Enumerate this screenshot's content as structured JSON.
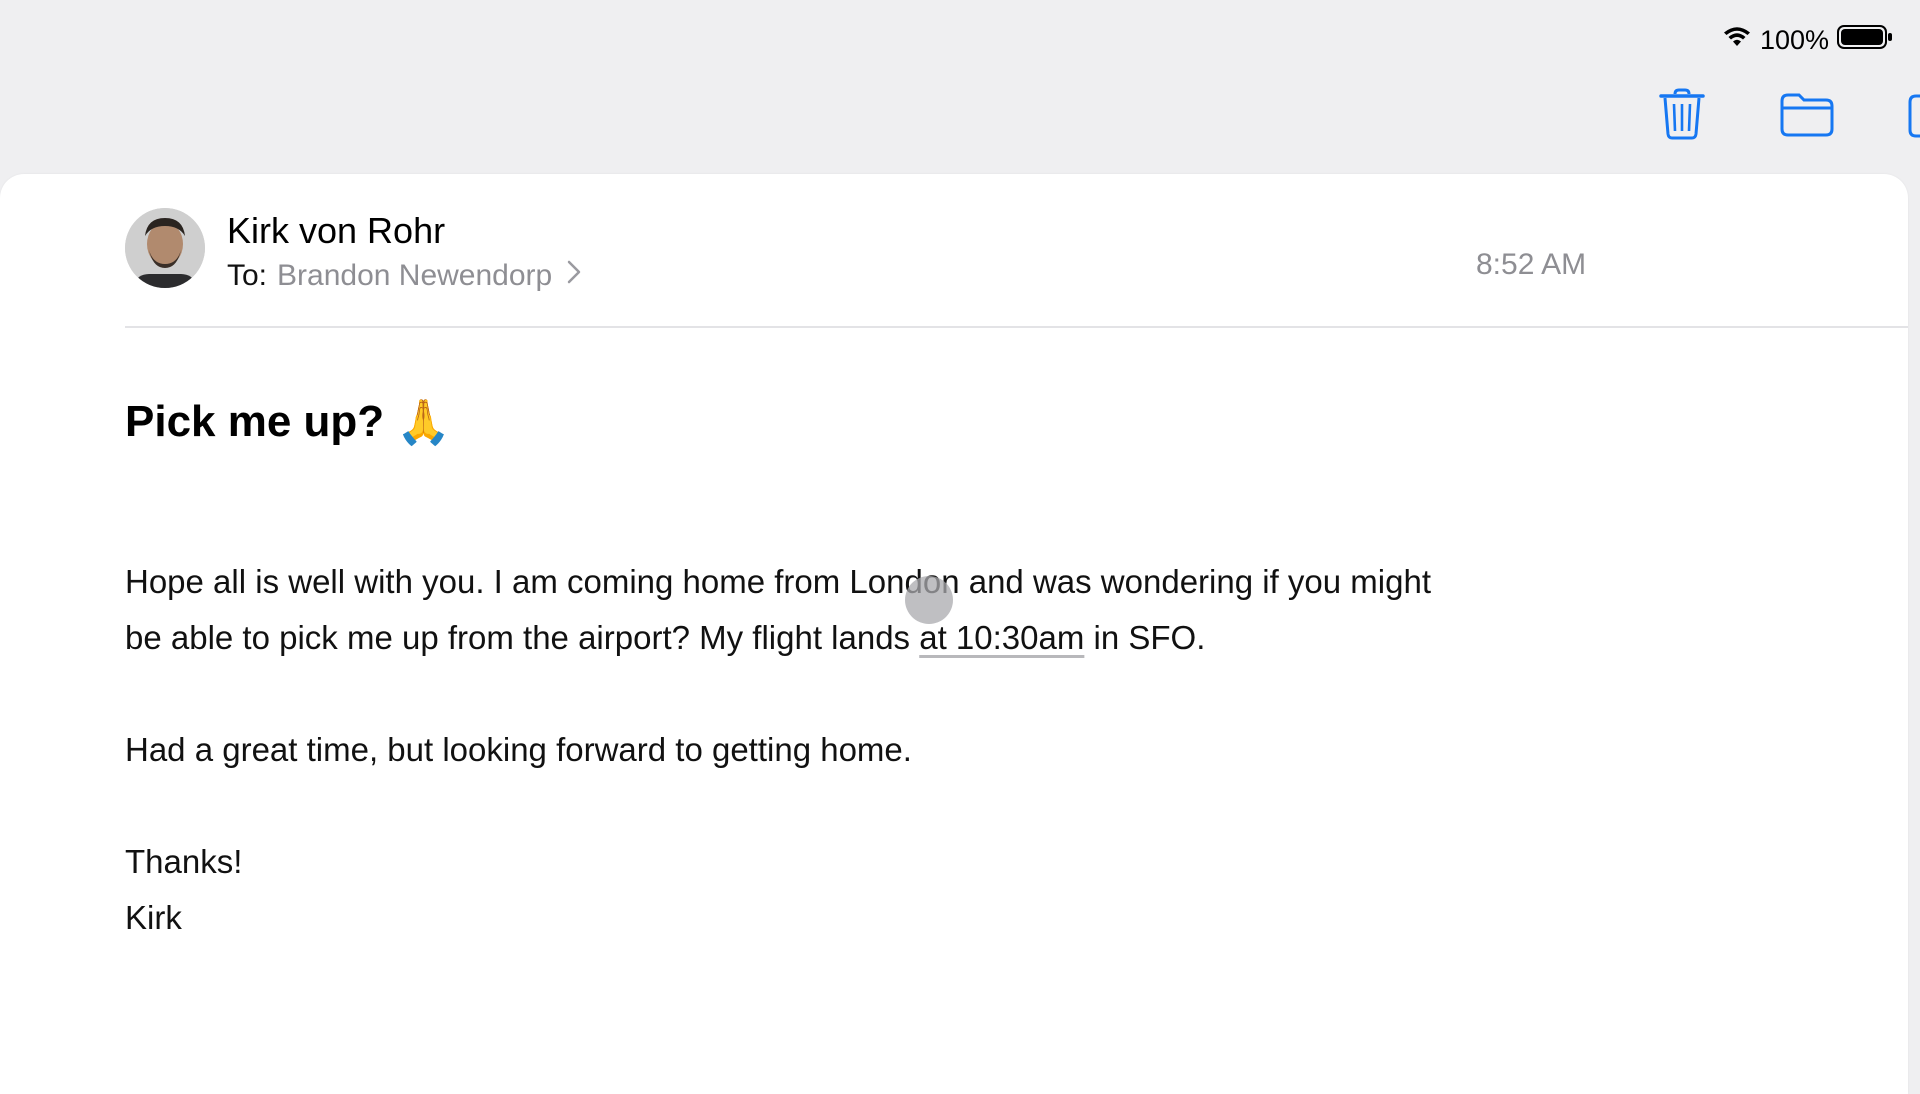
{
  "status": {
    "battery_text": "100%",
    "icons": [
      "wifi-icon",
      "battery-icon"
    ]
  },
  "toolbar": {
    "icons": [
      "trash-icon",
      "folder-icon",
      "compose-icon"
    ],
    "accent_color": "#1677f2"
  },
  "email": {
    "sender": "Kirk von Rohr",
    "to_label": "To:",
    "recipient": "Brandon Newendorp",
    "time": "8:52 AM",
    "subject": "Pick me up?",
    "subject_emoji": "🙏",
    "body": {
      "line1_pre": "Hope all is well with you. I am coming home from London and was wondering if you might",
      "line2_pre": "be able to pick me up from the airport? My flight lands ",
      "link_text": "at 10:30am",
      "line2_post": " in SFO.",
      "para2": "Had a great time, but looking forward to getting home.",
      "signoff1": "Thanks!",
      "signoff2": "Kirk"
    }
  }
}
